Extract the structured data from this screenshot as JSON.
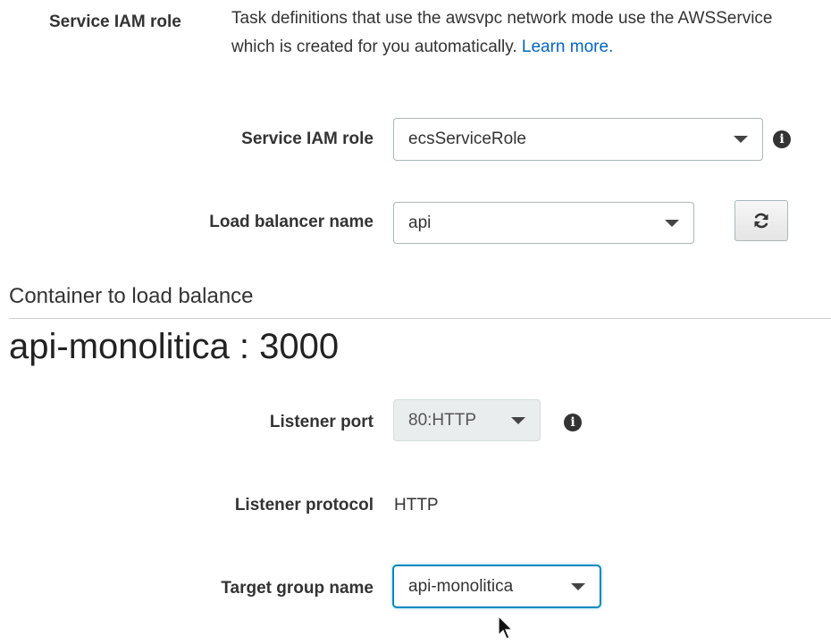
{
  "info": {
    "label": "Service IAM role",
    "description": "Task definitions that use the awsvpc network mode use the AWSService",
    "description_line2": "which is created for you automatically.",
    "learn_more": "Learn more."
  },
  "fields": {
    "service_iam_role": {
      "label": "Service IAM role",
      "value": "ecsServiceRole"
    },
    "load_balancer_name": {
      "label": "Load balancer name",
      "value": "api"
    },
    "listener_port": {
      "label": "Listener port",
      "value": "80:HTTP"
    },
    "listener_protocol": {
      "label": "Listener protocol",
      "value": "HTTP"
    },
    "target_group_name": {
      "label": "Target group name",
      "value": "api-monolitica"
    }
  },
  "section": {
    "title": "Container to load balance",
    "container": "api-monolitica : 3000"
  },
  "icons": {
    "info": "info-icon",
    "refresh": "refresh-icon",
    "caret": "chevron-down-icon"
  },
  "colors": {
    "link": "#0066c0",
    "focus": "#0073bb"
  }
}
